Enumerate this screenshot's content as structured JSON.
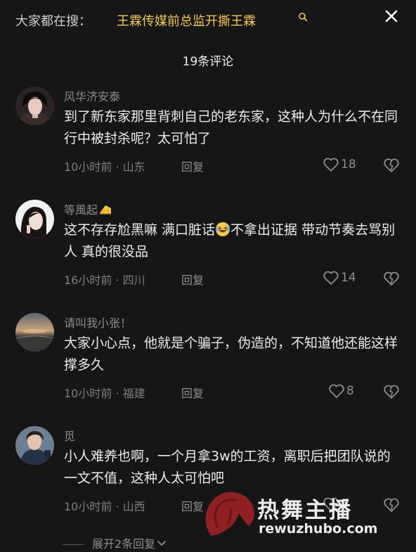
{
  "header": {
    "search_prefix": "大家都在搜：",
    "search_term": "王霖传媒前总监开撕王霖",
    "comment_count_title": "19条评论"
  },
  "comments": [
    {
      "author": "风华济安泰",
      "text": "到了新东家那里背刺自己的老东家，这种人为什么不在同行中被封杀呢？太可怕了",
      "time_location": "10小时前 · 山东",
      "reply_label": "回复",
      "likes": "18"
    },
    {
      "author": "等風起",
      "text_before_emoji": "这不存存尬黑嘛 满口脏话",
      "text_after_emoji": "不拿出证据 带动节奏去骂别人 真的很没品",
      "time_location": "16小时前 · 四川",
      "reply_label": "回复",
      "likes": "14"
    },
    {
      "author": "请叫我小张！",
      "text": "大家小心点，他就是个骗子，伪造的，不知道他还能这样撑多久",
      "time_location": "10小时前 · 福建",
      "reply_label": "回复",
      "likes": "8"
    },
    {
      "author": "觅",
      "text": "小人难养也啊，一个月拿3w的工资，离职后把团队说的一文不值，这种人太可怕吧",
      "time_location": "10小时前 · 山西",
      "reply_label": "回复",
      "likes": "5"
    }
  ],
  "expand_label": "展开2条回复",
  "watermark": {
    "title": "热舞主播",
    "url": "rewuzhubo.com"
  },
  "icons": {
    "search": "search-icon",
    "close": "close-icon",
    "like": "heart-outline-icon",
    "dislike": "broken-heart-icon",
    "expand": "chevron-down-icon"
  },
  "colors": {
    "background": "#161616",
    "search_highlight": "#f2c94c",
    "text_primary": "#ececec",
    "text_secondary": "#7e7e7e"
  }
}
